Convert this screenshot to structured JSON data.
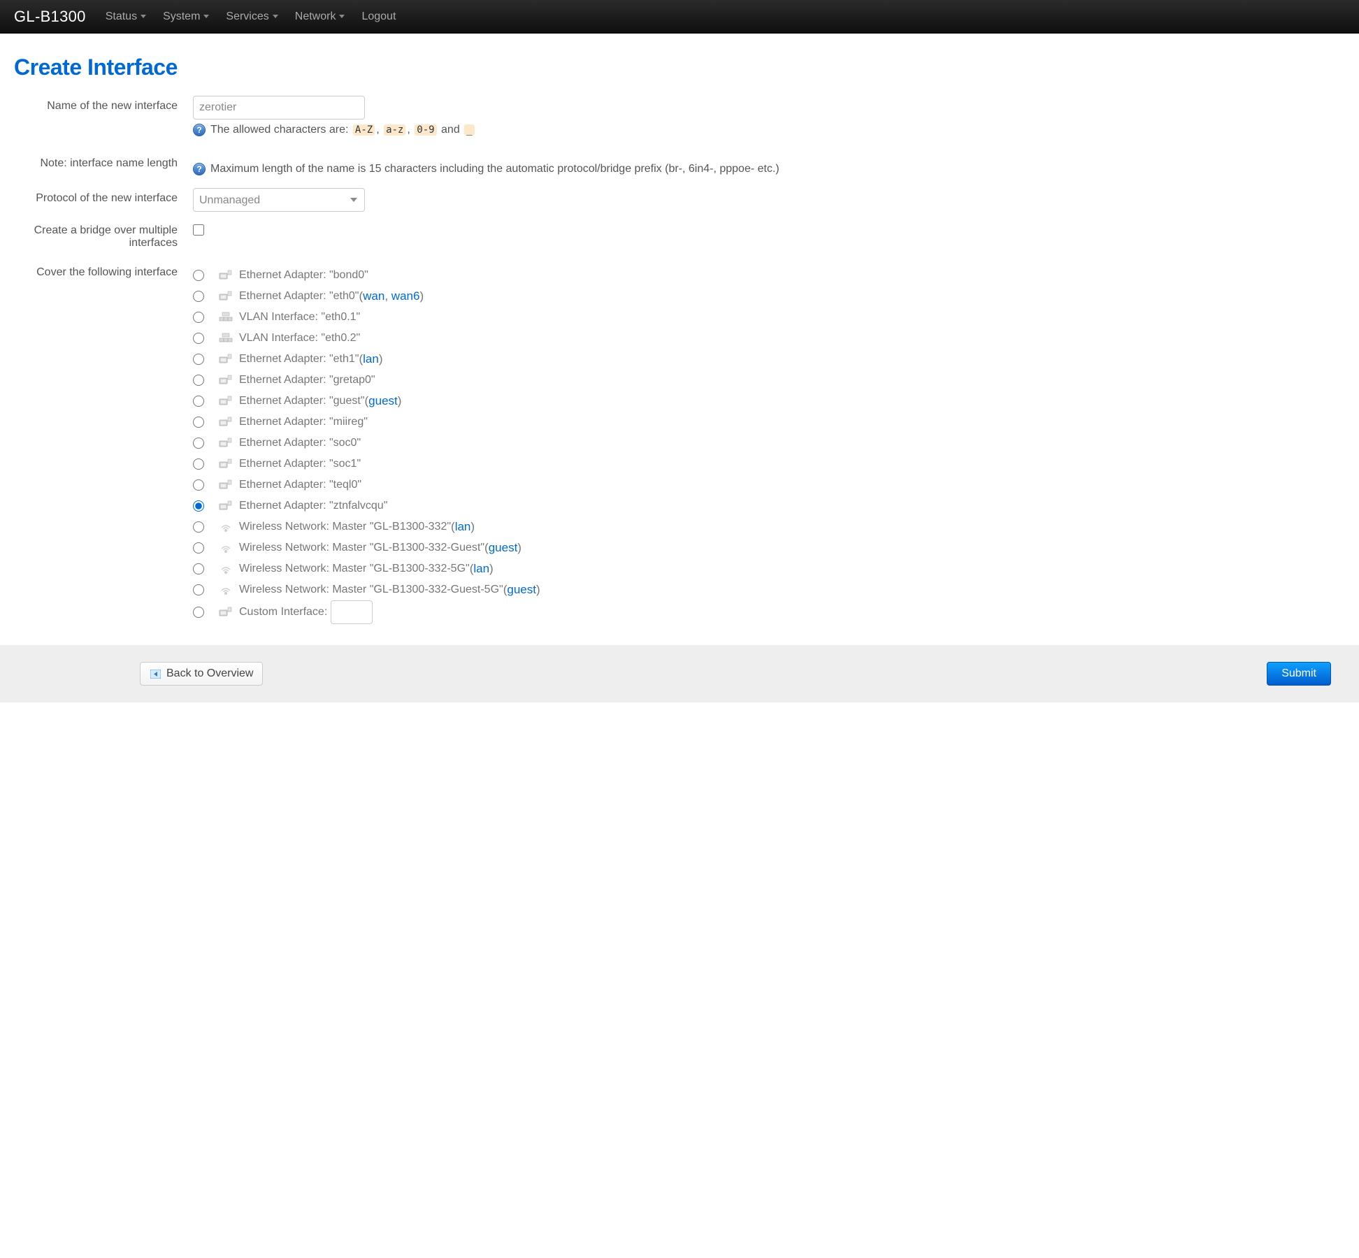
{
  "navbar": {
    "brand": "GL-B1300",
    "items": [
      "Status",
      "System",
      "Services",
      "Network",
      "Logout"
    ],
    "hasDropdown": [
      true,
      true,
      true,
      true,
      false
    ]
  },
  "pageTitle": "Create Interface",
  "form": {
    "nameLabel": "Name of the new interface",
    "nameValue": "zerotier",
    "allowedIntro": "The allowed characters are:",
    "allowedCodes": [
      "A-Z",
      "a-z",
      "0-9"
    ],
    "allowedAnd": "and",
    "allowedUnderscore": "_",
    "noteLabel": "Note: interface name length",
    "noteText": "Maximum length of the name is 15 characters including the automatic protocol/bridge prefix (br-, 6in4-, pppoe- etc.)",
    "protocolLabel": "Protocol of the new interface",
    "protocolValue": "Unmanaged",
    "bridgeLabel": "Create a bridge over multiple interfaces",
    "bridgeChecked": false,
    "coverLabel": "Cover the following interface",
    "customLabel": "Custom Interface:"
  },
  "interfaces": [
    {
      "label": "Ethernet Adapter: \"bond0\"",
      "icon": "eth",
      "selected": false,
      "links": []
    },
    {
      "label": "Ethernet Adapter: \"eth0\"",
      "icon": "eth",
      "selected": false,
      "links": [
        "wan",
        "wan6"
      ]
    },
    {
      "label": "VLAN Interface: \"eth0.1\"",
      "icon": "vlan",
      "selected": false,
      "links": []
    },
    {
      "label": "VLAN Interface: \"eth0.2\"",
      "icon": "vlan",
      "selected": false,
      "links": []
    },
    {
      "label": "Ethernet Adapter: \"eth1\"",
      "icon": "eth",
      "selected": false,
      "links": [
        "lan"
      ]
    },
    {
      "label": "Ethernet Adapter: \"gretap0\"",
      "icon": "eth",
      "selected": false,
      "links": []
    },
    {
      "label": "Ethernet Adapter: \"guest\"",
      "icon": "eth",
      "selected": false,
      "links": [
        "guest"
      ]
    },
    {
      "label": "Ethernet Adapter: \"miireg\"",
      "icon": "eth",
      "selected": false,
      "links": []
    },
    {
      "label": "Ethernet Adapter: \"soc0\"",
      "icon": "eth",
      "selected": false,
      "links": []
    },
    {
      "label": "Ethernet Adapter: \"soc1\"",
      "icon": "eth",
      "selected": false,
      "links": []
    },
    {
      "label": "Ethernet Adapter: \"teql0\"",
      "icon": "eth",
      "selected": false,
      "links": []
    },
    {
      "label": "Ethernet Adapter: \"ztnfalvcqu\"",
      "icon": "eth",
      "selected": true,
      "links": []
    },
    {
      "label": "Wireless Network: Master \"GL-B1300-332\"",
      "icon": "wifi",
      "selected": false,
      "links": [
        "lan"
      ]
    },
    {
      "label": "Wireless Network: Master \"GL-B1300-332-Guest\"",
      "icon": "wifi",
      "selected": false,
      "links": [
        "guest"
      ]
    },
    {
      "label": "Wireless Network: Master \"GL-B1300-332-5G\"",
      "icon": "wifi",
      "selected": false,
      "links": [
        "lan"
      ]
    },
    {
      "label": "Wireless Network: Master \"GL-B1300-332-Guest-5G\"",
      "icon": "wifi",
      "selected": false,
      "links": [
        "guest"
      ]
    }
  ],
  "actions": {
    "back": "Back to Overview",
    "submit": "Submit"
  }
}
